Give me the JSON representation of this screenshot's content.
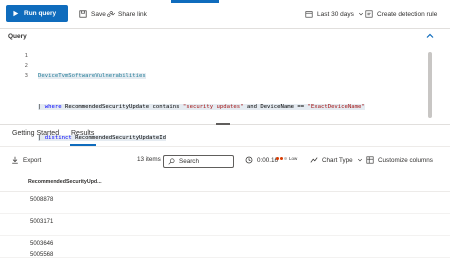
{
  "toolbar": {
    "run_query": "Run query",
    "save": "Save",
    "share_link": "Share link",
    "time_range": "Last 30 days",
    "create_rule": "Create detection rule"
  },
  "query": {
    "label": "Query",
    "lines": [
      {
        "num": "1"
      },
      {
        "num": "2"
      },
      {
        "num": "3"
      }
    ],
    "code": {
      "l1_table": "DeviceTvmSoftwareVulnerabilities",
      "l2_pipe": "| ",
      "l2_where": "where",
      "l2_field": " RecommendedSecurityUpdate ",
      "l2_contains": "contains",
      "l2_str1": " \"security updates\" ",
      "l2_and": "and",
      "l2_field2": " DeviceName ",
      "l2_eq": "==",
      "l2_str2": " \"ExactDeviceName\"",
      "l3_pipe": "| ",
      "l3_distinct": "distinct",
      "l3_field": " RecommendedSecurityUpdateId"
    }
  },
  "tabs": {
    "getting_started": "Getting Started",
    "results": "Results"
  },
  "results_bar": {
    "export": "Export",
    "item_count": "13 items",
    "search_placeholder": "Search",
    "elapsed": "0:00.16",
    "low": "Low",
    "chart_type": "Chart Type",
    "customize": "Customize columns"
  },
  "table": {
    "column": "RecommendedSecurityUpd...",
    "rows": [
      "5008878",
      "5003171",
      "5003646",
      "5005568"
    ]
  }
}
